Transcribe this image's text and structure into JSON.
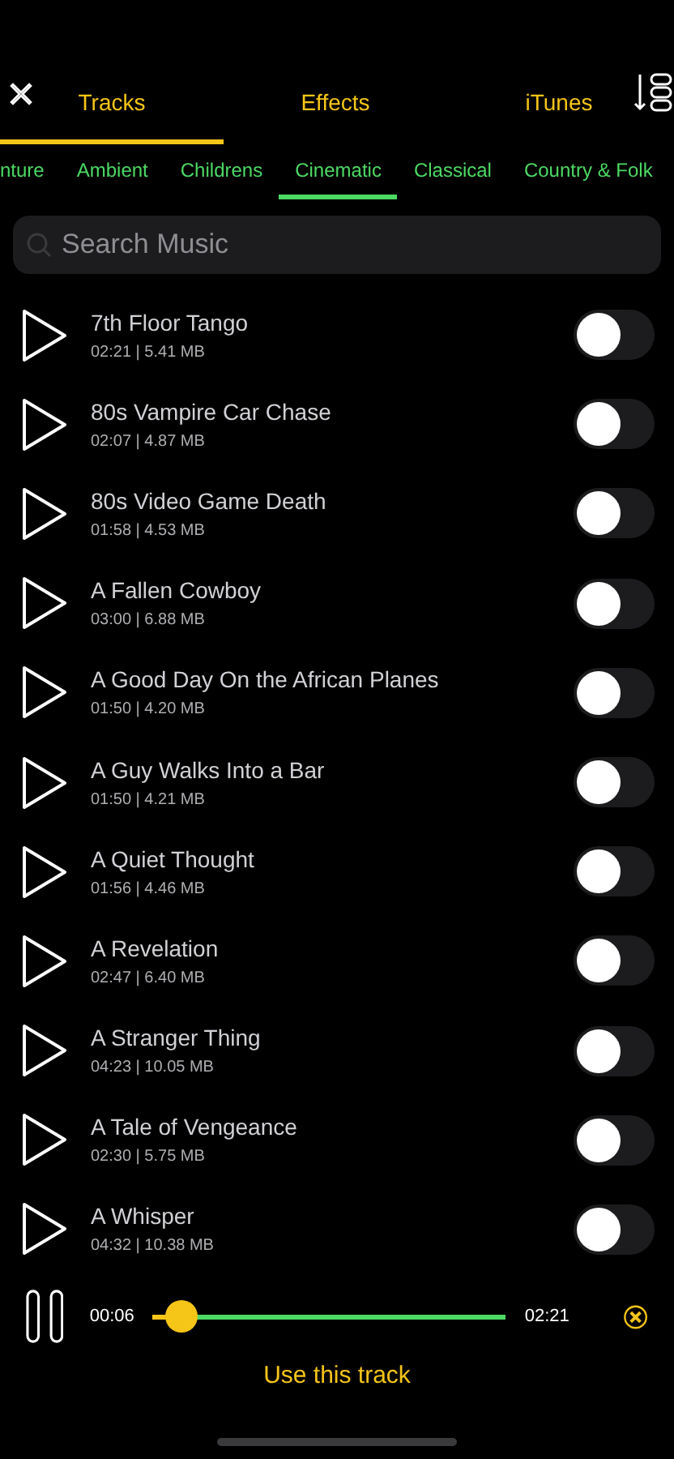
{
  "tabs": [
    {
      "label": "Tracks",
      "selected": true
    },
    {
      "label": "Effects",
      "selected": false
    },
    {
      "label": "iTunes",
      "selected": false
    }
  ],
  "genres": [
    {
      "label": "nture",
      "selected": false
    },
    {
      "label": "Ambient",
      "selected": false
    },
    {
      "label": "Childrens",
      "selected": false
    },
    {
      "label": "Cinematic",
      "selected": true
    },
    {
      "label": "Classical",
      "selected": false
    },
    {
      "label": "Country & Folk",
      "selected": false
    }
  ],
  "search": {
    "placeholder": "Search Music"
  },
  "tracks": [
    {
      "title": "7th Floor Tango",
      "info": "02:21 | 5.41 MB",
      "on": false
    },
    {
      "title": "80s Vampire Car Chase",
      "info": "02:07 | 4.87 MB",
      "on": false
    },
    {
      "title": "80s Video Game Death",
      "info": "01:58 | 4.53 MB",
      "on": false
    },
    {
      "title": "A Fallen Cowboy",
      "info": "03:00 | 6.88 MB",
      "on": false
    },
    {
      "title": "A Good Day On the African Planes",
      "info": "01:50 | 4.20 MB",
      "on": false
    },
    {
      "title": "A Guy Walks Into a Bar",
      "info": "01:50 | 4.21 MB",
      "on": false
    },
    {
      "title": "A Quiet Thought",
      "info": "01:56 | 4.46 MB",
      "on": false
    },
    {
      "title": "A Revelation",
      "info": "02:47 | 6.40 MB",
      "on": false
    },
    {
      "title": "A Stranger Thing",
      "info": "04:23 | 10.05 MB",
      "on": false
    },
    {
      "title": "A Tale of Vengeance",
      "info": "02:30 | 5.75 MB",
      "on": false
    },
    {
      "title": "A Whisper",
      "info": "04:32 | 10.38 MB",
      "on": false
    }
  ],
  "player": {
    "elapsed": "00:06",
    "duration": "02:21",
    "level": 0.08
  },
  "use_button": "Use this track"
}
